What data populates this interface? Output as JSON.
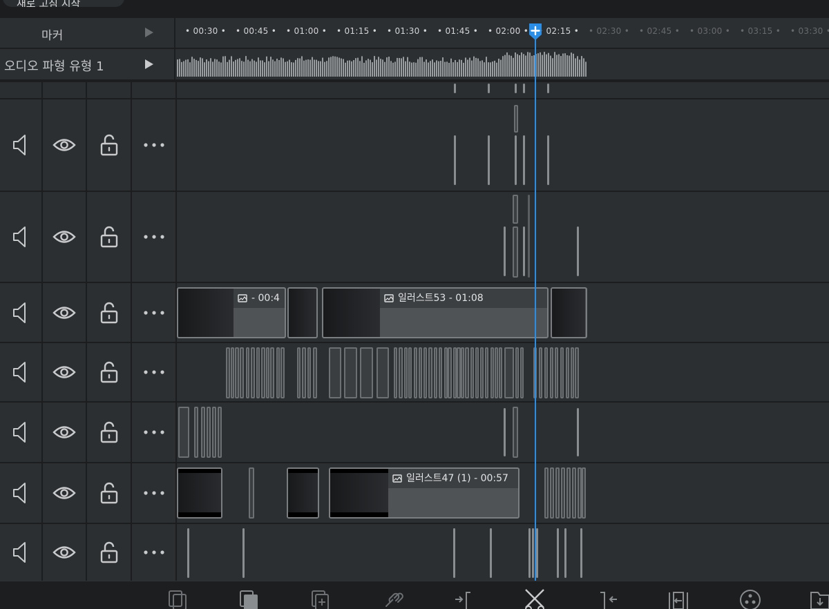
{
  "top": {
    "label": "새로 고침 시작"
  },
  "marker_row": {
    "label": "마커"
  },
  "waveform_row": {
    "label": "오디오 파형 유형 1"
  },
  "ruler": {
    "past_ticks": [
      "00:30",
      "00:45",
      "01:00",
      "01:15",
      "01:30",
      "01:45",
      "02:00",
      "02:15"
    ],
    "future_ticks": [
      "02:30",
      "02:45",
      "03:00",
      "03:15",
      "03:30"
    ]
  },
  "playhead": {
    "time": "02:10",
    "color": "#2b8ee6"
  },
  "track_icons": [
    "speaker-icon",
    "eye-icon",
    "unlock-icon",
    "more-icon"
  ],
  "tracks": [
    {
      "id": "track-1"
    },
    {
      "id": "track-2"
    },
    {
      "id": "track-3",
      "clips": [
        {
          "title": "- 00:4"
        },
        {
          "title": ""
        },
        {
          "title": "일러스트53 - 01:08"
        },
        {
          "title": ""
        }
      ]
    },
    {
      "id": "track-4"
    },
    {
      "id": "track-5"
    },
    {
      "id": "track-6",
      "clips": [
        {
          "title": ""
        },
        {
          "title": ""
        },
        {
          "title": "일러스트47 (1) - 00:57"
        }
      ]
    },
    {
      "id": "track-7"
    }
  ],
  "toolbar": {
    "buttons": [
      "copy-icon",
      "duplicate-icon",
      "add-layer-icon",
      "link-icon",
      "trim-start-icon",
      "split-icon",
      "trim-end-icon",
      "slip-icon",
      "effects-icon",
      "export-icon"
    ]
  },
  "colors": {
    "accent": "#2b8ee6",
    "track_bg": "#2c2f32",
    "clip_border": "#7b7e81"
  }
}
